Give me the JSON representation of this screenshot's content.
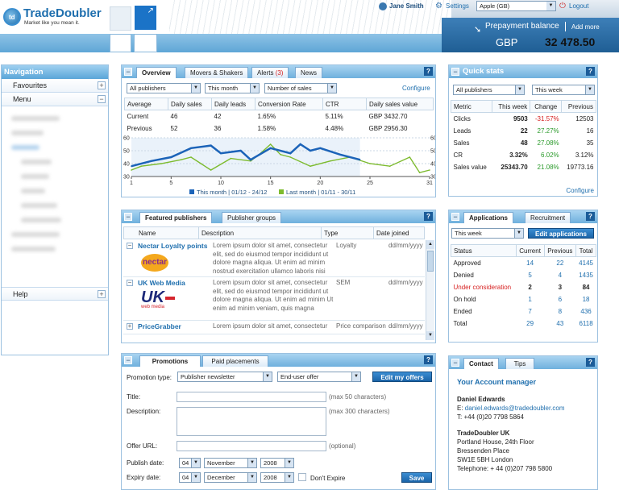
{
  "header": {
    "logo_text": "TradeDoubler",
    "logo_mark": "td",
    "tagline": "Market like you mean it.",
    "user_name": "Jane Smith",
    "settings_label": "Settings",
    "country": "Apple (GB)",
    "logout_label": "Logout",
    "prepayment_label": "Prepayment balance",
    "add_more_label": "Add more",
    "currency": "GBP",
    "balance": "32 478.50"
  },
  "nav": {
    "title": "Navigation",
    "items": [
      {
        "label": "Favourites",
        "sign": "+"
      },
      {
        "label": "Menu",
        "sign": "−"
      }
    ],
    "help_label": "Help",
    "help_sign": "+"
  },
  "overview": {
    "tabs": [
      "Overview",
      "Movers & Shakers",
      "Alerts",
      "News"
    ],
    "alerts_count": "(3)",
    "filter_publishers": "All publishers",
    "filter_period": "This month",
    "filter_metric": "Number of sales",
    "configure": "Configure",
    "columns": [
      "Average",
      "Daily sales",
      "Daily leads",
      "Conversion Rate",
      "CTR",
      "Daily sales value"
    ],
    "rows": [
      [
        "Current",
        "46",
        "42",
        "1.65%",
        "5.11%",
        "GBP 3432.70"
      ],
      [
        "Previous",
        "52",
        "36",
        "1.58%",
        "4.48%",
        "GBP 2956.30"
      ]
    ]
  },
  "chart_data": {
    "type": "line",
    "x_ticks": [
      1,
      5,
      10,
      15,
      20,
      25,
      31
    ],
    "xlim": [
      1,
      31
    ],
    "ylim": [
      30,
      60
    ],
    "y_ticks": [
      30,
      40,
      50,
      60
    ],
    "legend": [
      "This month | 01/12 - 24/12",
      "Last month | 01/11 - 30/11"
    ],
    "series": [
      {
        "name": "This month | 01/12 - 24/12",
        "color": "#1b63b8",
        "x": [
          1,
          3,
          5,
          7,
          9,
          10,
          12,
          13,
          15,
          17,
          18,
          19,
          20,
          22,
          24
        ],
        "y": [
          38,
          42,
          45,
          52,
          54,
          48,
          50,
          43,
          52,
          48,
          55,
          50,
          52,
          47,
          43
        ]
      },
      {
        "name": "Last month | 01/11 - 30/11",
        "color": "#7dbb2e",
        "x": [
          1,
          2,
          4,
          6,
          7,
          8,
          9,
          11,
          13,
          14,
          15,
          16,
          17,
          19,
          21,
          23,
          25,
          27,
          29,
          30,
          31
        ],
        "y": [
          35,
          38,
          40,
          43,
          45,
          40,
          35,
          44,
          42,
          48,
          55,
          47,
          45,
          38,
          42,
          45,
          40,
          38,
          45,
          33,
          35
        ]
      }
    ]
  },
  "quick_stats": {
    "title": "Quick stats",
    "filter_publishers": "All publishers",
    "filter_period": "This week",
    "columns": [
      "Metric",
      "This week",
      "Change",
      "Previous"
    ],
    "rows": [
      {
        "metric": "Clicks",
        "value": "9503",
        "change": "-31.57%",
        "dir": "down",
        "previous": "12503"
      },
      {
        "metric": "Leads",
        "value": "22",
        "change": "27.27%",
        "dir": "up",
        "previous": "16"
      },
      {
        "metric": "Sales",
        "value": "48",
        "change": "27.08%",
        "dir": "up",
        "previous": "35"
      },
      {
        "metric": "CR",
        "value": "3.32%",
        "change": "6.02%",
        "dir": "up",
        "previous": "3.12%"
      },
      {
        "metric": "Sales value",
        "value": "25343.70",
        "change": "21.08%",
        "dir": "up",
        "previous": "19773.16"
      }
    ],
    "configure": "Configure"
  },
  "featured": {
    "tabs": [
      "Featured publishers",
      "Publisher groups"
    ],
    "columns": [
      "Name",
      "Description",
      "Type",
      "Date joined"
    ],
    "rows": [
      {
        "sign": "−",
        "name": "Nectar Loyalty points",
        "logo": "nectar",
        "description": "Lorem ipsum dolor sit amet, consectetur elit, sed do eiusmod tempor incididunt ut dolore magna aliqua. Ut enim ad minim nostrud exercitation ullamco laboris nisi",
        "type": "Loyalty",
        "date": "dd/mm/yyyy"
      },
      {
        "sign": "−",
        "name": "UK Web Media",
        "logo": "UK",
        "logo_sub": "web media",
        "description": "Lorem ipsum dolor sit amet, consectetur elit, sed do eiusmod tempor incididunt ut dolore magna aliqua. Ut enim ad minim Ut enim ad minim veniam, quis magna",
        "type": "SEM",
        "date": "dd/mm/yyyy"
      },
      {
        "sign": "+",
        "name": "PriceGrabber",
        "logo": "",
        "description": "Lorem ipsum dolor sit amet, consectetur",
        "type": "Price comparison",
        "date": "dd/mm/yyyy"
      }
    ]
  },
  "applications": {
    "tabs": [
      "Applications",
      "Recruitment"
    ],
    "filter_period": "This week",
    "edit_button": "Edit applications",
    "columns": [
      "Status",
      "Current",
      "Previous",
      "Total"
    ],
    "rows": [
      {
        "status": "Approved",
        "current": "14",
        "previous": "22",
        "total": "4145",
        "highlight": false
      },
      {
        "status": "Denied",
        "current": "5",
        "previous": "4",
        "total": "1435",
        "highlight": false
      },
      {
        "status": "Under consideration",
        "current": "2",
        "previous": "3",
        "total": "84",
        "highlight": true
      },
      {
        "status": "On hold",
        "current": "1",
        "previous": "6",
        "total": "18",
        "highlight": false
      },
      {
        "status": "Ended",
        "current": "7",
        "previous": "8",
        "total": "436",
        "highlight": false
      },
      {
        "status": "Total",
        "current": "29",
        "previous": "43",
        "total": "6118",
        "highlight": false
      }
    ]
  },
  "promotions": {
    "tabs": [
      "Promotions",
      "Paid placements"
    ],
    "type_label": "Promotion type:",
    "type_value": "Publisher newsletter",
    "offer_value": "End-user offer",
    "edit_button": "Edit my offers",
    "title_label": "Title:",
    "title_hint": "(max 50 characters)",
    "description_label": "Description:",
    "description_hint": "(max 300 characters)",
    "offer_url_label": "Offer URL:",
    "offer_url_hint": "(optional)",
    "publish_label": "Publish date:",
    "publish_day": "04",
    "publish_month": "November",
    "publish_year": "2008",
    "expiry_label": "Expiry date:",
    "expiry_day": "04",
    "expiry_month": "December",
    "expiry_year": "2008",
    "dont_expire": "Don't Expire",
    "save_button": "Save"
  },
  "contact": {
    "tabs": [
      "Contact",
      "Tips"
    ],
    "heading": "Your Account manager",
    "manager_name": "Daniel Edwards",
    "email_prefix": "E:",
    "email": "daniel.edwards@tradedoubler.com",
    "phone": "T:   +44 (0)20 7798 5864",
    "company": "TradeDoubler UK",
    "address": [
      "Portland House, 24th Floor",
      "Bressenden Place",
      "SW1E 5BH London",
      "Telephone: + 44 (0)207 798 5800"
    ]
  }
}
